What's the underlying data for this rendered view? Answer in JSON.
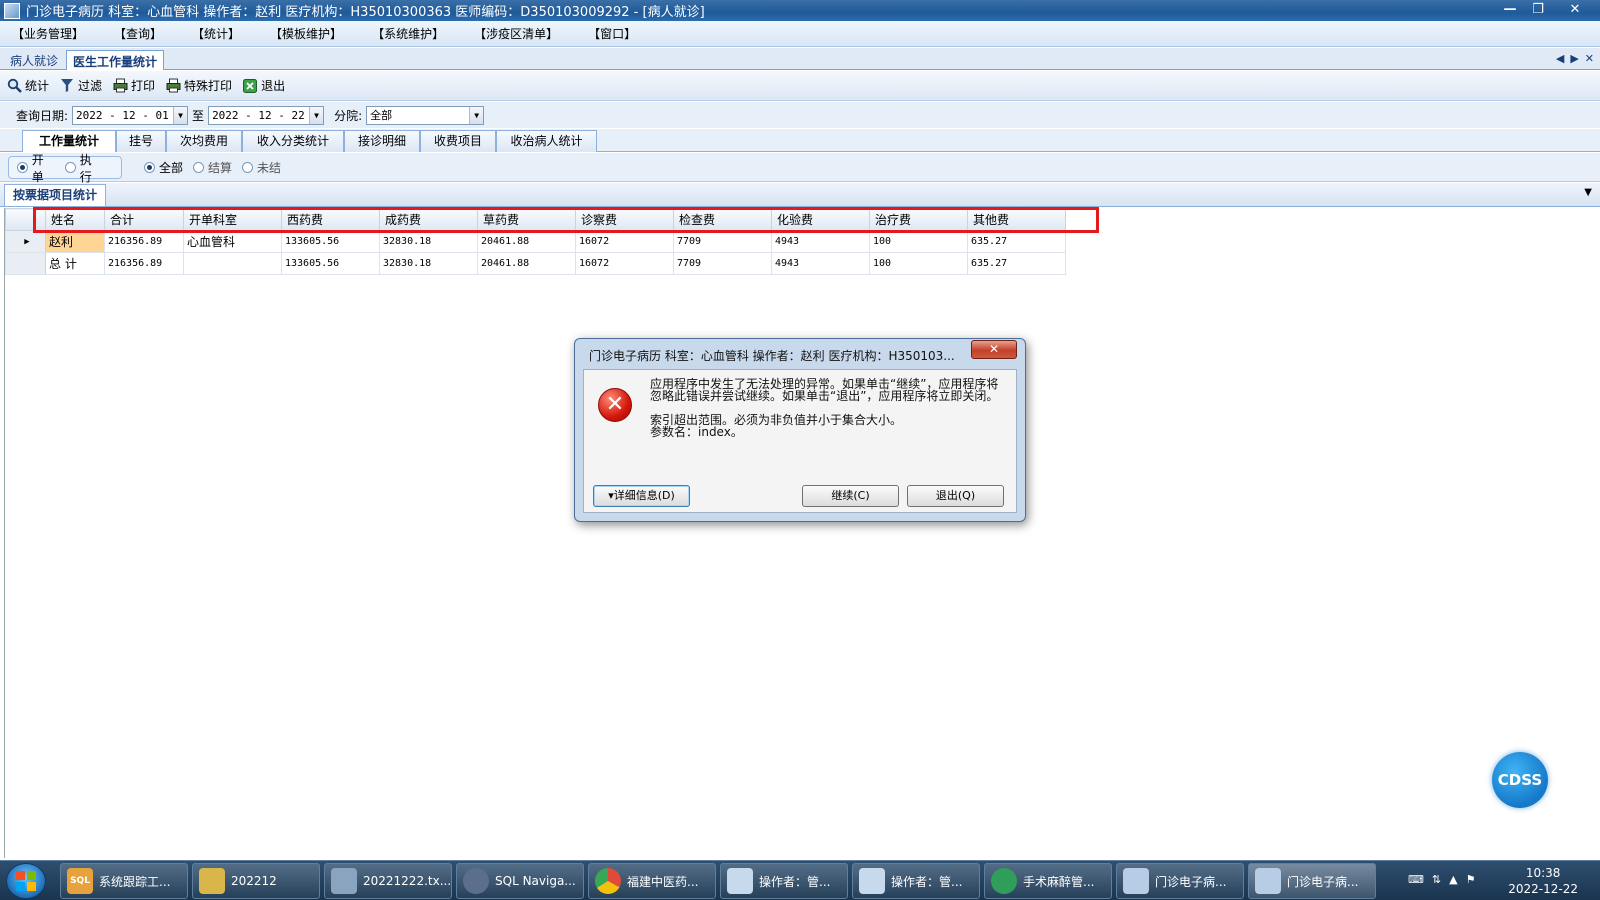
{
  "window": {
    "title": "门诊电子病历   科室：心血管科  操作者：赵利  医疗机构：H35010300363  医师编码：D350103009292 - [病人就诊]",
    "minimize": "—",
    "restore": "❐",
    "close": "✕"
  },
  "menu": [
    "【业务管理】",
    "【查询】",
    "【统计】",
    "【模板维护】",
    "【系统维护】",
    "【涉疫区清单】",
    "【窗口】"
  ],
  "doc_tabs": {
    "inactive": "病人就诊",
    "active": "医生工作量统计",
    "nav": [
      "◀",
      "▶",
      "✕"
    ]
  },
  "toolbar": [
    {
      "label": "统计",
      "icon": "magnifier-icon"
    },
    {
      "label": "过滤",
      "icon": "filter-icon"
    },
    {
      "label": "打印",
      "icon": "printer-icon"
    },
    {
      "label": "特殊打印",
      "icon": "printer-icon"
    },
    {
      "label": "退出",
      "icon": "exit-icon"
    }
  ],
  "filters": {
    "query_date_label": "查询日期:",
    "date_from": "2022 - 12 - 01",
    "to_label": "至",
    "date_to": "2022 - 12 - 22",
    "branch_label": "分院:",
    "branch_value": "全部",
    "drop_glyph": "▼"
  },
  "func_tabs": [
    "工作量统计",
    "挂号",
    "次均费用",
    "收入分类统计",
    "接诊明细",
    "收费项目",
    "收治病人统计"
  ],
  "radio_group1": [
    {
      "label": "开单",
      "checked": true
    },
    {
      "label": "执行",
      "checked": false
    }
  ],
  "radio_group2": [
    {
      "label": "全部",
      "checked": true
    },
    {
      "label": "结算",
      "checked": false
    },
    {
      "label": "未结",
      "checked": false
    }
  ],
  "group_title": "按票据项目统计",
  "group_drop": "▼",
  "table": {
    "row_marker": "▶",
    "columns": [
      "姓名",
      "合计",
      "开单科室",
      "西药费",
      "成药费",
      "草药费",
      "诊察费",
      "检查费",
      "化验费",
      "治疗费",
      "其他费"
    ],
    "rows": [
      [
        "赵利",
        "216356.89",
        "心血管科",
        "133605.56",
        "32830.18",
        "20461.88",
        "16072",
        "7709",
        "4943",
        "100",
        "635.27"
      ],
      [
        "总 计",
        "216356.89",
        "",
        "133605.56",
        "32830.18",
        "20461.88",
        "16072",
        "7709",
        "4943",
        "100",
        "635.27"
      ]
    ]
  },
  "dialog": {
    "title": "门诊电子病历   科室：心血管科  操作者：赵利  医疗机构：H350103...",
    "close": "✕",
    "error_glyph": "✕",
    "message1": "应用程序中发生了无法处理的异常。如果单击“继续”，应用程序将忽略此错误并尝试继续。如果单击“退出”，应用程序将立即关闭。",
    "message2_line1": "索引超出范围。必须为非负值并小于集合大小。",
    "message2_line2": "参数名：index。",
    "btn_detail": "▾详细信息(D)",
    "btn_continue": "继续(C)",
    "btn_quit": "退出(Q)"
  },
  "cdss": "CDSS",
  "taskbar": {
    "items": [
      {
        "label": "系统跟踪工...",
        "color": "#e6a23c",
        "badge": "SQL"
      },
      {
        "label": "202212",
        "color": "#d9b64a",
        "badge": ""
      },
      {
        "label": "20221222.tx...",
        "color": "#8aa4c0",
        "badge": ""
      },
      {
        "label": "SQL Naviga...",
        "color": "#5b6f8c",
        "badge": ""
      },
      {
        "label": "福建中医药...",
        "color": "#e04a3a",
        "badge": ""
      },
      {
        "label": "操作者：管...",
        "color": "#c7d9ec",
        "badge": ""
      },
      {
        "label": "操作者：管...",
        "color": "#c7d9ec",
        "badge": ""
      },
      {
        "label": "手术麻醉管...",
        "color": "#2f9e5a",
        "badge": ""
      },
      {
        "label": "门诊电子病...",
        "color": "#b7cde6",
        "badge": ""
      },
      {
        "label": "门诊电子病...",
        "color": "#b7cde6",
        "badge": ""
      }
    ],
    "time": "10:38",
    "date": "2022-12-22"
  }
}
